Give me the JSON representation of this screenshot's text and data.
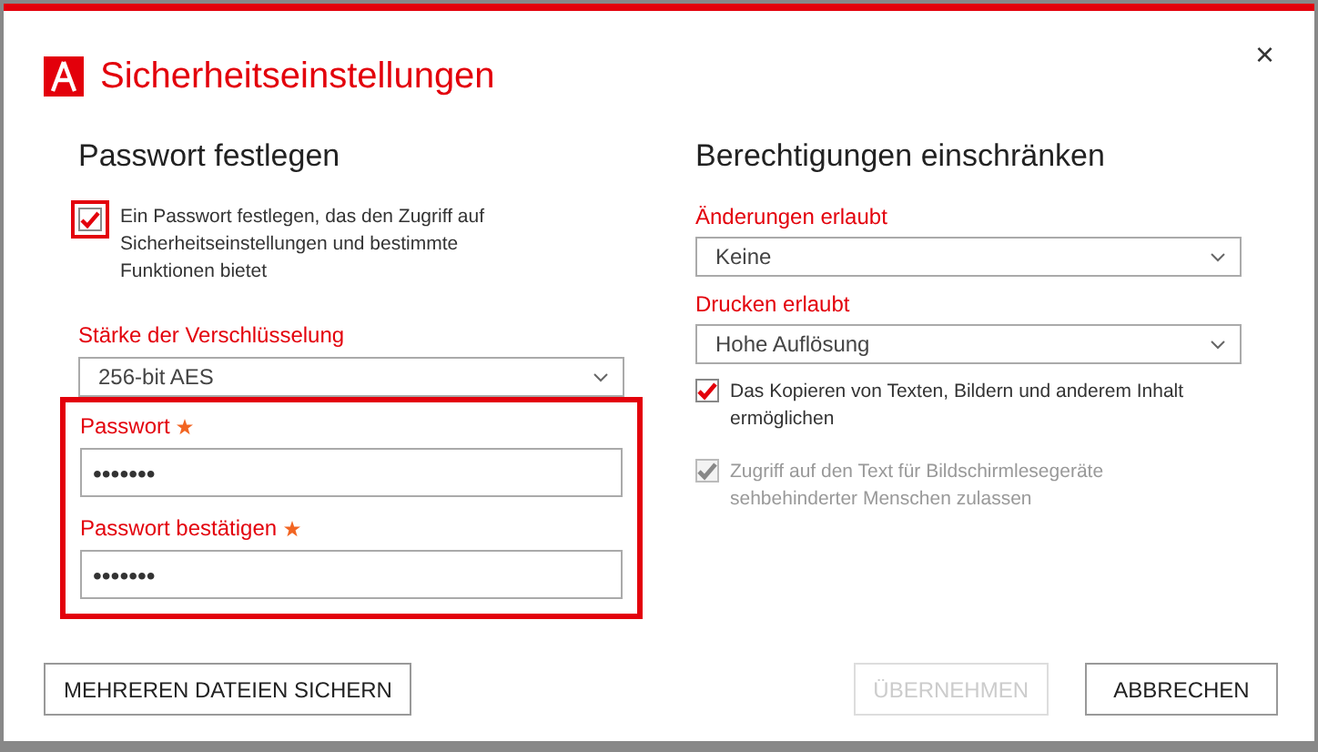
{
  "window": {
    "title": "Sicherheitseinstellungen",
    "close": "×"
  },
  "password_section": {
    "heading": "Passwort festlegen",
    "checkbox": {
      "label": "Ein Passwort festlegen, das den Zugriff auf Sicherheitseinstellungen und bestimmte Funktionen bietet",
      "checked": true,
      "highlighted": true
    },
    "encryption": {
      "label": "Stärke der Verschlüsselung",
      "value": "256-bit AES"
    },
    "fields_highlighted": true,
    "fields": [
      {
        "label": "Passwort",
        "required": true,
        "value": "•••••••"
      },
      {
        "label": "Passwort bestätigen",
        "required": true,
        "value": "•••••••"
      }
    ]
  },
  "permissions_section": {
    "heading": "Berechtigungen einschränken",
    "dropdowns": [
      {
        "label": "Änderungen erlaubt",
        "value": "Keine"
      },
      {
        "label": "Drucken erlaubt",
        "value": "Hohe Auflösung"
      }
    ],
    "checkboxes": [
      {
        "label": "Das Kopieren von Texten, Bildern und anderem Inhalt ermöglichen",
        "checked": true,
        "disabled": false
      },
      {
        "label": "Zugriff auf den Text für Bildschirmlesegeräte sehbehinderter Menschen zulassen",
        "checked": true,
        "disabled": true
      }
    ]
  },
  "footer": {
    "left_buttons": [
      {
        "label": "MEHREREN DATEIEN SICHERN",
        "disabled": false
      }
    ],
    "right_buttons": [
      {
        "label": "ÜBERNEHMEN",
        "disabled": true
      },
      {
        "label": "ABBRECHEN",
        "disabled": false
      }
    ]
  }
}
